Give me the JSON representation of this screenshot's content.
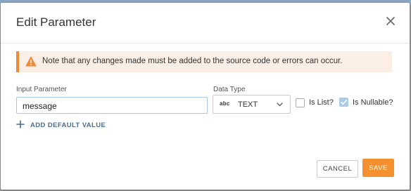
{
  "dialog": {
    "title": "Edit Parameter",
    "close_icon": "close-icon"
  },
  "alert": {
    "icon": "warning-icon",
    "text": "Note that any changes made must be added to the source code or errors can occur."
  },
  "form": {
    "input_parameter_label": "Input Parameter",
    "input_parameter_value": "message",
    "data_type_label": "Data Type",
    "data_type_icon_text": "abc",
    "data_type_value": "TEXT",
    "is_list_label": "Is List?",
    "is_list_checked": false,
    "is_nullable_label": "Is Nullable?",
    "is_nullable_checked": true,
    "add_default_label": "ADD DEFAULT VALUE"
  },
  "footer": {
    "cancel_label": "CANCEL",
    "save_label": "SAVE"
  },
  "colors": {
    "accent": "#f5902f",
    "alert_bg": "#fbeee4",
    "alert_border": "#f08a3a",
    "link": "#4a6e8f",
    "checked": "#a9cce8"
  }
}
